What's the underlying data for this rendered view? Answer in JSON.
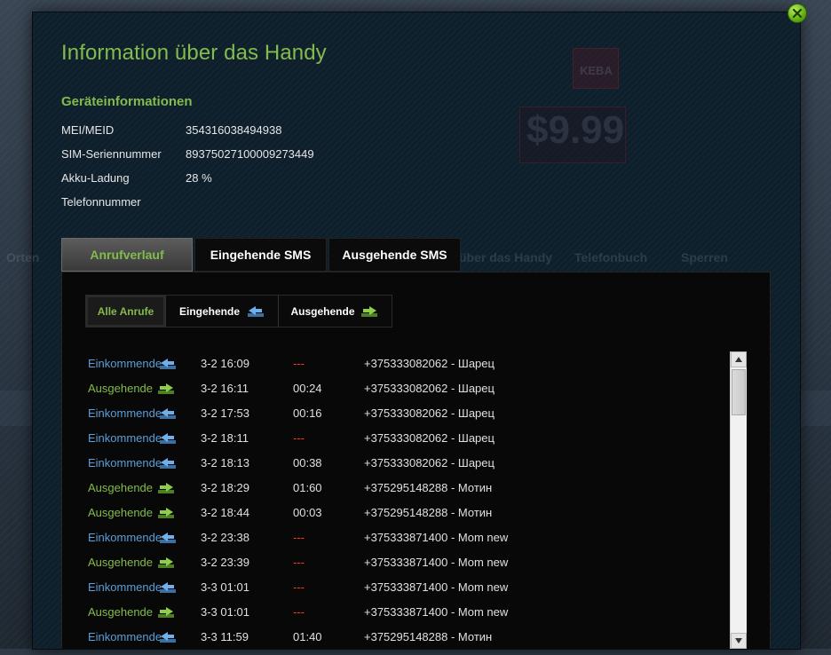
{
  "modal": {
    "title": "Information über das Handy",
    "section_title": "Geräteinformationen"
  },
  "device_info": [
    {
      "label": "MEI/MEID",
      "value": "354316038494938"
    },
    {
      "label": "SIM-Seriennummer",
      "value": "89375027100009273449"
    },
    {
      "label": "Akku-Ladung",
      "value": "28 %"
    },
    {
      "label": "Telefonnummer",
      "value": ""
    }
  ],
  "tabs": [
    {
      "label": "Anrufverlauf",
      "active": true
    },
    {
      "label": "Eingehende SMS",
      "active": false
    },
    {
      "label": "Ausgehende SMS",
      "active": false
    }
  ],
  "sub_tabs": [
    {
      "label": "Alle Anrufe",
      "icon": "",
      "active": true
    },
    {
      "label": "Eingehende",
      "icon": "incoming-arrow-icon",
      "active": false
    },
    {
      "label": "Ausgehende",
      "icon": "outgoing-arrow-icon",
      "active": false
    }
  ],
  "calls": [
    {
      "type": "Einkommende",
      "dir": "in",
      "time": "3-2 16:09",
      "duration": "---",
      "missed": true,
      "number": "+375333082062 - Шарец"
    },
    {
      "type": "Ausgehende",
      "dir": "out",
      "time": "3-2 16:11",
      "duration": "00:24",
      "missed": false,
      "number": "+375333082062 - Шарец"
    },
    {
      "type": "Einkommende",
      "dir": "in",
      "time": "3-2 17:53",
      "duration": "00:16",
      "missed": false,
      "number": "+375333082062 - Шарец"
    },
    {
      "type": "Einkommende",
      "dir": "in",
      "time": "3-2 18:11",
      "duration": "---",
      "missed": true,
      "number": "+375333082062 - Шарец"
    },
    {
      "type": "Einkommende",
      "dir": "in",
      "time": "3-2 18:13",
      "duration": "00:38",
      "missed": false,
      "number": "+375333082062 - Шарец"
    },
    {
      "type": "Ausgehende",
      "dir": "out",
      "time": "3-2 18:29",
      "duration": "01:60",
      "missed": false,
      "number": "+375295148288 - Мотин"
    },
    {
      "type": "Ausgehende",
      "dir": "out",
      "time": "3-2 18:44",
      "duration": "00:03",
      "missed": false,
      "number": "+375295148288 - Мотин"
    },
    {
      "type": "Einkommende",
      "dir": "in",
      "time": "3-2 23:38",
      "duration": "---",
      "missed": true,
      "number": "+375333871400 - Mom new"
    },
    {
      "type": "Ausgehende",
      "dir": "out",
      "time": "3-2 23:39",
      "duration": "---",
      "missed": true,
      "number": "+375333871400 - Mom new"
    },
    {
      "type": "Einkommende",
      "dir": "in",
      "time": "3-3 01:01",
      "duration": "---",
      "missed": true,
      "number": "+375333871400 - Mom new"
    },
    {
      "type": "Ausgehende",
      "dir": "out",
      "time": "3-3 01:01",
      "duration": "---",
      "missed": true,
      "number": "+375333871400 - Mom new"
    },
    {
      "type": "Einkommende",
      "dir": "in",
      "time": "3-3 11:59",
      "duration": "01:40",
      "missed": false,
      "number": "+375295148288 - Мотин"
    }
  ],
  "colors": {
    "accent_green": "#83bb4c",
    "incoming_blue": "#5b9ed8",
    "missed_red": "#ff3b2f",
    "modal_bg": "#0e1f2c"
  },
  "background_ghost": {
    "price": "$9.99",
    "badge": "KEBA",
    "nav": [
      "Orten",
      "über das Handy",
      "Telefonbuch",
      "Sperren"
    ]
  }
}
